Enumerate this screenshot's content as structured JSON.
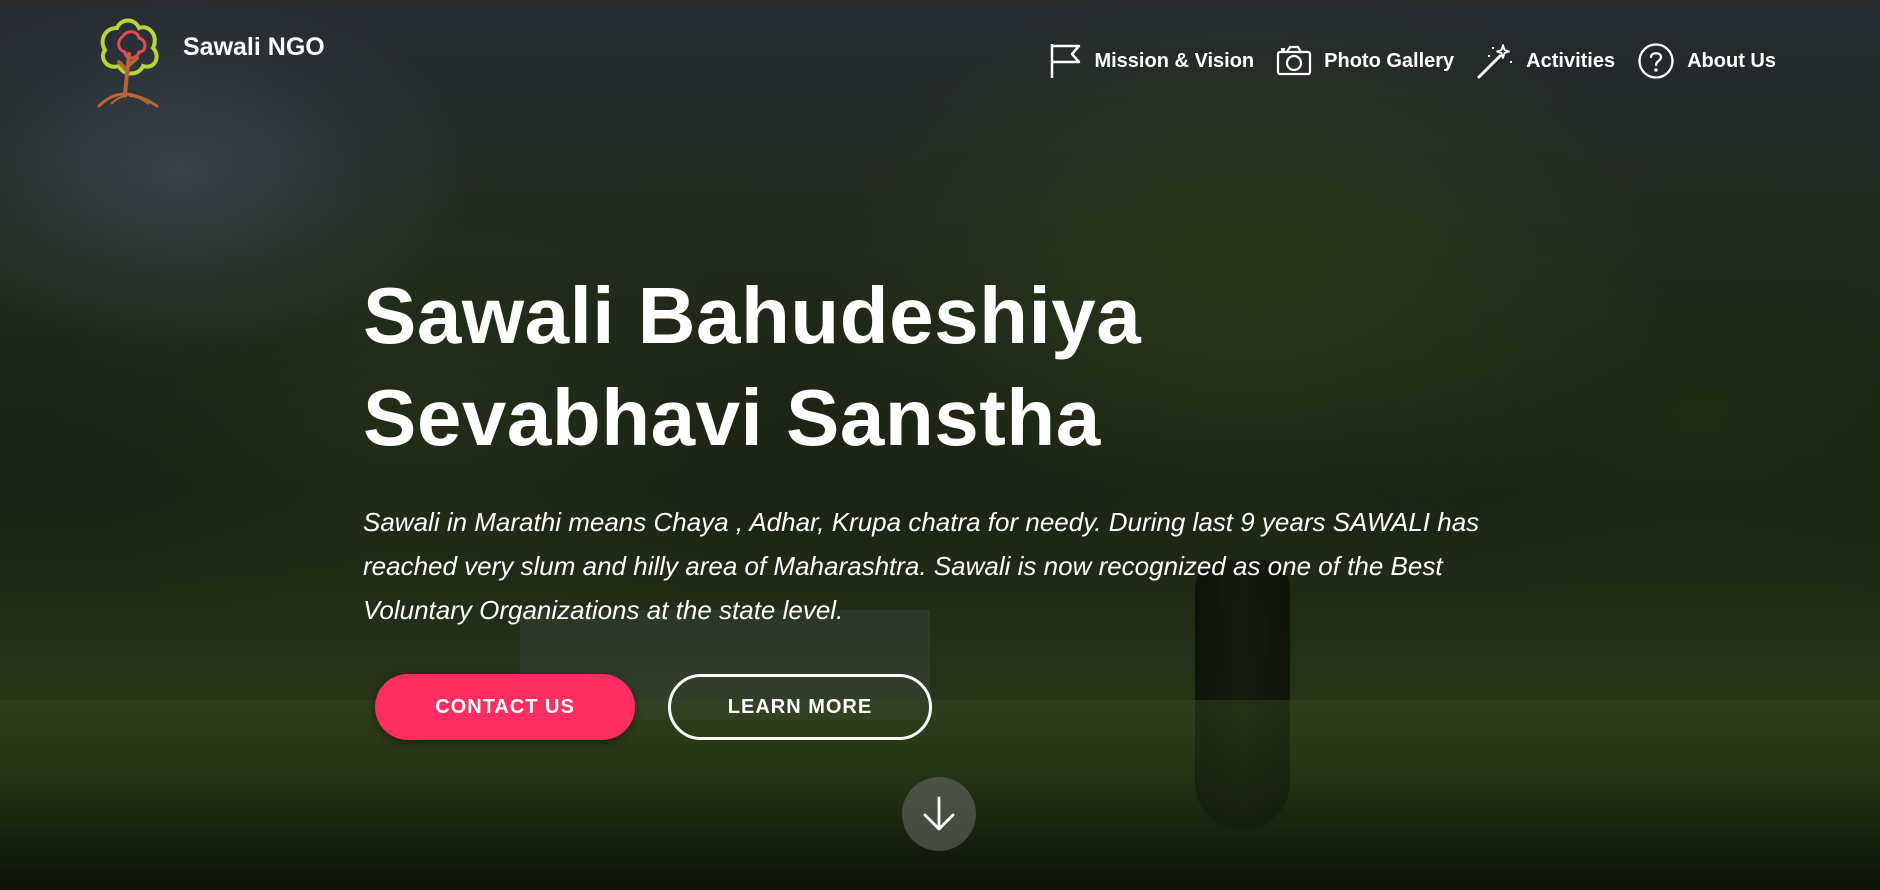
{
  "brand": {
    "name": "Sawali NGO",
    "logo_icon": "tree-logo-icon"
  },
  "nav": {
    "items": [
      {
        "label": "Mission & Vision",
        "icon": "flag-icon"
      },
      {
        "label": "Photo Gallery",
        "icon": "camera-icon"
      },
      {
        "label": "Activities",
        "icon": "magic-wand-icon"
      },
      {
        "label": "About Us",
        "icon": "question-circle-icon"
      }
    ]
  },
  "hero": {
    "title_line1": "Sawali Bahudeshiya",
    "title_line2": "Sevabhavi Sanstha",
    "description": "Sawali in Marathi means Chaya , Adhar, Krupa chatra for needy. During last 9 years SAWALI has reached very slum and hilly area of Maharashtra. Sawali is now recognized as one of the Best Voluntary Organizations at the state level.",
    "primary_button": "CONTACT US",
    "secondary_button": "LEARN MORE",
    "scroll_icon": "arrow-down-icon"
  },
  "colors": {
    "accent": "#ff2d62",
    "text": "#ffffff"
  }
}
